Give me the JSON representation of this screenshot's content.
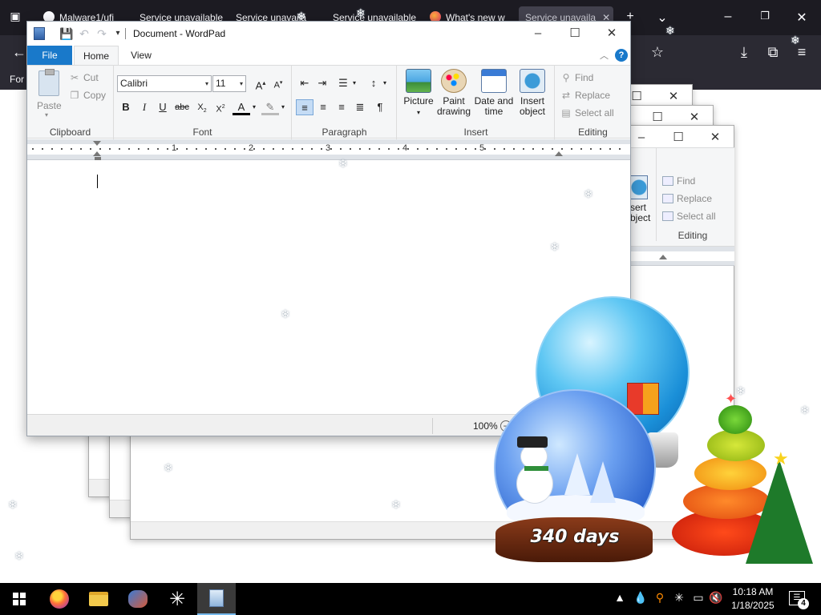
{
  "browser": {
    "tabs": [
      {
        "label": "Malware1/ufi",
        "favicon": "github-icon"
      },
      {
        "label": "Service unavailable",
        "favicon": "page-icon"
      },
      {
        "label": "Service unavaila",
        "favicon": "page-icon"
      },
      {
        "label": "Service unavailable",
        "favicon": "page-icon"
      },
      {
        "label": "What's new w",
        "favicon": "firefox-icon"
      },
      {
        "label": "Service unavaila",
        "favicon": "page-icon",
        "active": true
      }
    ],
    "bookmarks_text": "For"
  },
  "wordpad": {
    "title": "Document - WordPad",
    "tabs": [
      "File",
      "Home",
      "View"
    ],
    "clipboard": {
      "paste": "Paste",
      "cut": "Cut",
      "copy": "Copy",
      "label": "Clipboard"
    },
    "font": {
      "family": "Calibri",
      "size": "11",
      "label": "Font"
    },
    "paragraph": {
      "label": "Paragraph"
    },
    "insert": {
      "picture": "Picture",
      "paint1": "Paint",
      "paint2": "drawing",
      "date1": "Date and",
      "date2": "time",
      "obj1": "Insert",
      "obj2": "object",
      "label": "Insert"
    },
    "editing": {
      "find": "Find",
      "replace": "Replace",
      "select_all": "Select all",
      "label": "Editing"
    },
    "ruler_numbers": [
      "1",
      "2",
      "3",
      "4",
      "5"
    ],
    "zoom": "100%"
  },
  "back_window": {
    "insert1": "sert",
    "insert2": "bject",
    "find": "Find",
    "replace": "Replace",
    "select_all": "Select all",
    "label": "Editing"
  },
  "widget": {
    "days": "340 days"
  },
  "taskbar": {
    "time": "10:18 AM",
    "date": "1/18/2025",
    "notifications": "4"
  },
  "colors": {
    "accent": "#1979ca",
    "taskbar": "#000000",
    "browser_bg": "#1c1b22"
  }
}
